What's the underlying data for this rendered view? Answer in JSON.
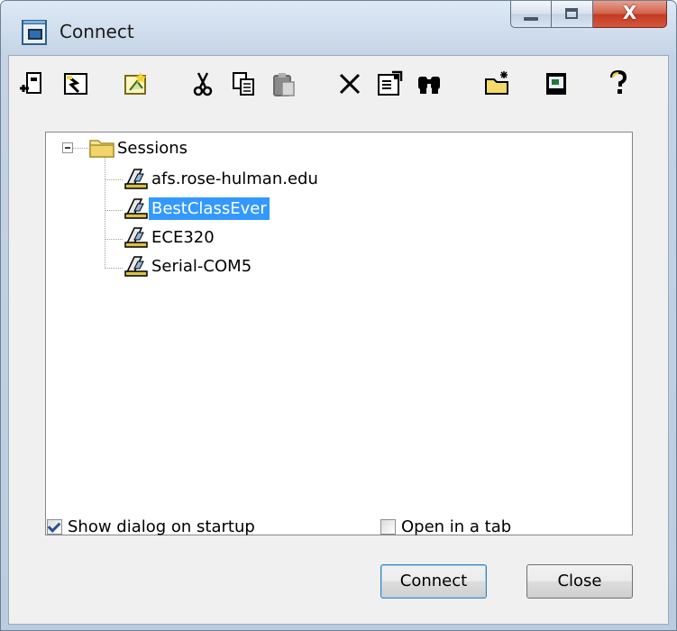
{
  "window": {
    "title": "Connect",
    "close_glyph": "X"
  },
  "toolbar": {
    "icons": [
      "connect-icon",
      "quick-connect-icon",
      "new-session-icon",
      "cut-icon",
      "copy-icon",
      "paste-icon",
      "delete-icon",
      "properties-icon",
      "find-icon",
      "new-folder-icon",
      "desktop-shortcut-icon",
      "help-icon"
    ]
  },
  "tree": {
    "root": "Sessions",
    "sessions": [
      "afs.rose-hulman.edu",
      "BestClassEver",
      "ECE320",
      "Serial-COM5"
    ],
    "selected": "BestClassEver"
  },
  "options": {
    "show_dialog": {
      "label": "Show dialog on startup",
      "checked": true
    },
    "open_in_tab": {
      "label": "Open in a tab",
      "checked": false
    }
  },
  "buttons": {
    "connect": "Connect",
    "close": "Close"
  },
  "colors": {
    "selection": "#3399ff",
    "close_button": "#c7432a",
    "default_button_border": "#3c7fb1"
  }
}
